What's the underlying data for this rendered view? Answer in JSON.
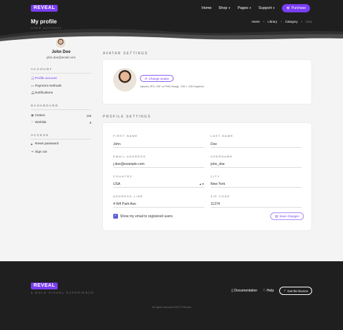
{
  "brand": {
    "logo": "REVEAL",
    "tagline": "A BOLD VISUAL EXPERIENCE"
  },
  "nav": {
    "items": [
      {
        "label": "Home",
        "has_menu": false
      },
      {
        "label": "Shop",
        "has_menu": true
      },
      {
        "label": "Pages",
        "has_menu": true
      },
      {
        "label": "Support",
        "has_menu": true
      }
    ],
    "purchase_label": "Purchase"
  },
  "header": {
    "title": "My profile",
    "subtitle": "USER ACCOUNT",
    "breadcrumb": [
      "Home",
      "Library",
      "Category",
      "Data"
    ]
  },
  "profile": {
    "name": "John Doe",
    "email": "john.doe@email.com"
  },
  "sidebar": {
    "account_heading": "ACCOUNT",
    "account_items": [
      {
        "label": "Profile account",
        "icon": "user-icon",
        "active": true
      },
      {
        "label": "Payment methods",
        "icon": "credit-card-icon",
        "active": false
      },
      {
        "label": "Notifications",
        "icon": "bell-icon",
        "active": false
      }
    ],
    "dashboard_heading": "DASHBOARD",
    "dashboard_items": [
      {
        "label": "Orders",
        "icon": "bag-icon",
        "count": "125"
      },
      {
        "label": "Wishlist",
        "icon": "heart-icon",
        "count": "8"
      }
    ],
    "access_heading": "ACCESS",
    "access_items": [
      {
        "label": "Reset password",
        "icon": "lock-icon"
      },
      {
        "label": "Sign out",
        "icon": "logout-icon"
      }
    ]
  },
  "avatar_settings": {
    "title": "AVATAR SETTINGS",
    "change_label": "Change avatar",
    "note": "Upload JPG, GIF or PNG image. 130 × 130 required."
  },
  "profile_settings": {
    "title": "PROFILE SETTINGS",
    "first_name": {
      "label": "FIRST NAME",
      "value": "John"
    },
    "last_name": {
      "label": "LAST NAME",
      "value": "Doe"
    },
    "email": {
      "label": "EMAIL ADDRESS",
      "value": "j.doe@example.com"
    },
    "username": {
      "label": "USERNAME",
      "value": "john_doe"
    },
    "country": {
      "label": "COUNTRY",
      "value": "USA"
    },
    "city": {
      "label": "CITY",
      "value": "New York"
    },
    "address": {
      "label": "ADDRESS LINE",
      "value": "4 W4 Park Ave."
    },
    "zip": {
      "label": "ZIP CODE",
      "value": "11374"
    },
    "show_email_label": "Show my email to registered users",
    "show_email_checked": true,
    "save_label": "Save changes"
  },
  "footer": {
    "documentation": "Documentation",
    "help": "Help",
    "license": "Get the licence",
    "copyright": "All rights reserved 2020 © Reveal"
  },
  "colors": {
    "accent": "#7a3df1",
    "dark": "#1f1f1f",
    "background": "#f4f4f4",
    "checkbox": "#5a5fd6"
  }
}
